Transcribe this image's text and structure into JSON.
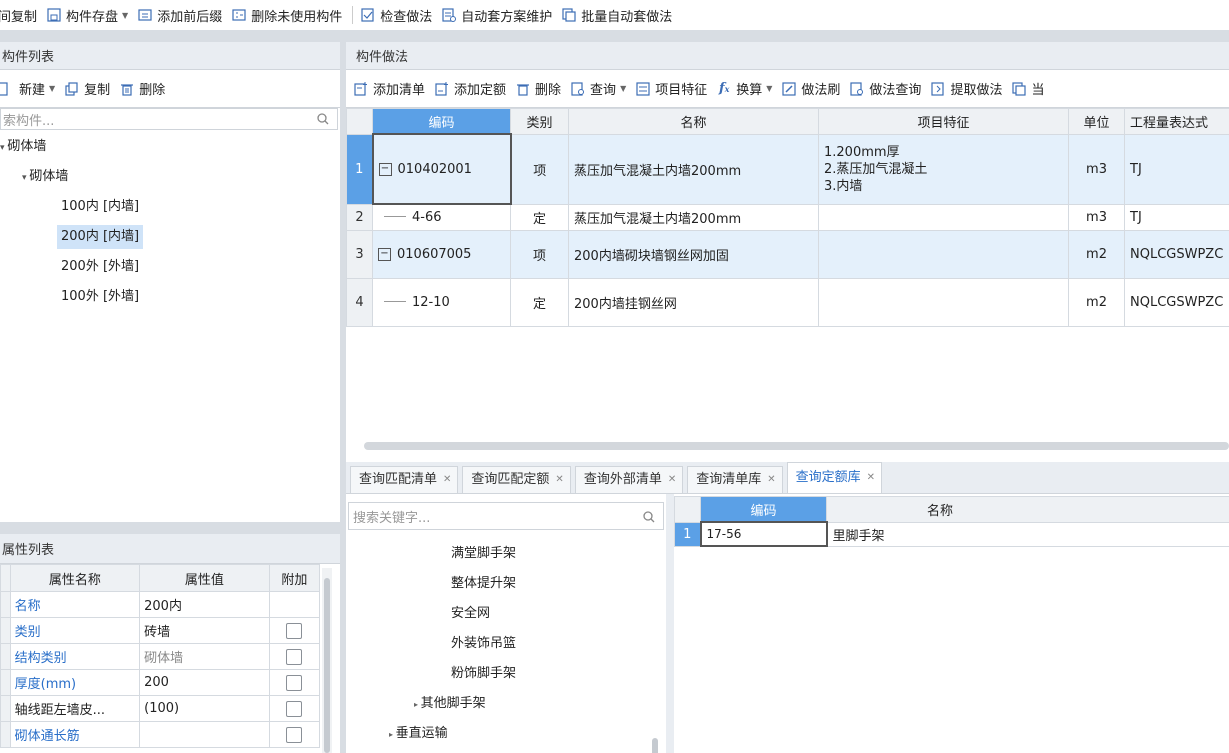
{
  "toolbar": {
    "items": [
      {
        "label": "间复制",
        "icon": "copy-icon"
      },
      {
        "label": "构件存盘",
        "icon": "save-icon",
        "dropdown": true
      },
      {
        "label": "添加前后缀",
        "icon": "affix-icon"
      },
      {
        "label": "删除未使用构件",
        "icon": "delete-unused-icon"
      },
      {
        "label": "检查做法",
        "icon": "check-icon"
      },
      {
        "label": "自动套方案维护",
        "icon": "scheme-icon"
      },
      {
        "label": "批量自动套做法",
        "icon": "batch-icon"
      }
    ]
  },
  "left": {
    "title": "构件列表",
    "toolbar": {
      "new": "新建",
      "copy": "复制",
      "delete": "删除"
    },
    "search_placeholder": "索构件...",
    "tree": [
      {
        "label": "砌体墙",
        "level": 0,
        "expanded": true
      },
      {
        "label": "砌体墙",
        "level": 1,
        "expanded": true
      },
      {
        "label": "100内 [内墙]",
        "level": 2
      },
      {
        "label": "200内 [内墙]",
        "level": 2,
        "selected": true
      },
      {
        "label": "200外 [外墙]",
        "level": 2
      },
      {
        "label": "100外 [外墙]",
        "level": 2
      }
    ]
  },
  "props": {
    "title": "属性列表",
    "headers": {
      "name": "属性名称",
      "value": "属性值",
      "extra": "附加"
    },
    "rows": [
      {
        "name": "名称",
        "value": "200内",
        "blue": true,
        "check": false
      },
      {
        "name": "类别",
        "value": "砖墙",
        "blue": true,
        "check": true
      },
      {
        "name": "结构类别",
        "value": "砌体墙",
        "blue": true,
        "check": true,
        "gray": true
      },
      {
        "name": "厚度(mm)",
        "value": "200",
        "blue": true,
        "check": true
      },
      {
        "name": "轴线距左墙皮...",
        "value": "(100)",
        "blue": false,
        "check": true
      },
      {
        "name": "砌体通长筋",
        "value": "",
        "blue": true,
        "check": true
      }
    ]
  },
  "method": {
    "title": "构件做法",
    "toolbar": [
      {
        "label": "添加清单",
        "icon": "add-list-icon"
      },
      {
        "label": "添加定额",
        "icon": "add-quota-icon"
      },
      {
        "label": "删除",
        "icon": "trash-icon"
      },
      {
        "label": "查询",
        "icon": "query-icon",
        "dropdown": true
      },
      {
        "label": "项目特征",
        "icon": "feature-icon"
      },
      {
        "label": "换算",
        "icon": "fx-icon",
        "dropdown": true
      },
      {
        "label": "做法刷",
        "icon": "brush-icon"
      },
      {
        "label": "做法查询",
        "icon": "method-query-icon"
      },
      {
        "label": "提取做法",
        "icon": "extract-icon"
      },
      {
        "label": "当",
        "icon": "current-icon"
      }
    ],
    "headers": {
      "code": "编码",
      "kind": "类别",
      "name": "名称",
      "feature": "项目特征",
      "unit": "单位",
      "expr": "工程量表达式"
    },
    "rows": [
      {
        "num": "1",
        "code": "010402001",
        "kind": "项",
        "name": "蒸压加气混凝土内墙200mm",
        "feature": [
          "1.200mm厚",
          "2.蒸压加气混凝土",
          "3.内墙"
        ],
        "unit": "m3",
        "expr": "TJ",
        "parent": true,
        "selected": true
      },
      {
        "num": "2",
        "code": "4-66",
        "kind": "定",
        "name": "蒸压加气混凝土内墙200mm",
        "feature": [],
        "unit": "m3",
        "expr": "TJ",
        "parent": false
      },
      {
        "num": "3",
        "code": "010607005",
        "kind": "项",
        "name": "200内墙砌块墙钢丝网加固",
        "feature": [],
        "unit": "m2",
        "expr": "NQLCGSWPZC",
        "parent": true
      },
      {
        "num": "4",
        "code": "12-10",
        "kind": "定",
        "name": "200内墙挂钢丝网",
        "feature": [],
        "unit": "m2",
        "expr": "NQLCGSWPZC",
        "parent": false
      }
    ]
  },
  "bottom": {
    "tabs": [
      {
        "label": "查询匹配清单",
        "active": false
      },
      {
        "label": "查询匹配定额",
        "active": false
      },
      {
        "label": "查询外部清单",
        "active": false
      },
      {
        "label": "查询清单库",
        "active": false
      },
      {
        "label": "查询定额库",
        "active": true
      }
    ],
    "search_placeholder": "搜索关键字...",
    "lib_tree": [
      {
        "label": "满堂脚手架",
        "level": 2
      },
      {
        "label": "整体提升架",
        "level": 2
      },
      {
        "label": "安全网",
        "level": 2
      },
      {
        "label": "外装饰吊篮",
        "level": 2
      },
      {
        "label": "粉饰脚手架",
        "level": 2
      },
      {
        "label": "其他脚手架",
        "level": 1,
        "collapsed": true
      },
      {
        "label": "垂直运输",
        "level": 0,
        "collapsed": true
      }
    ],
    "result_headers": {
      "code": "编码",
      "name": "名称"
    },
    "results": [
      {
        "num": "1",
        "code": "17-56",
        "name": "里脚手架"
      }
    ]
  }
}
